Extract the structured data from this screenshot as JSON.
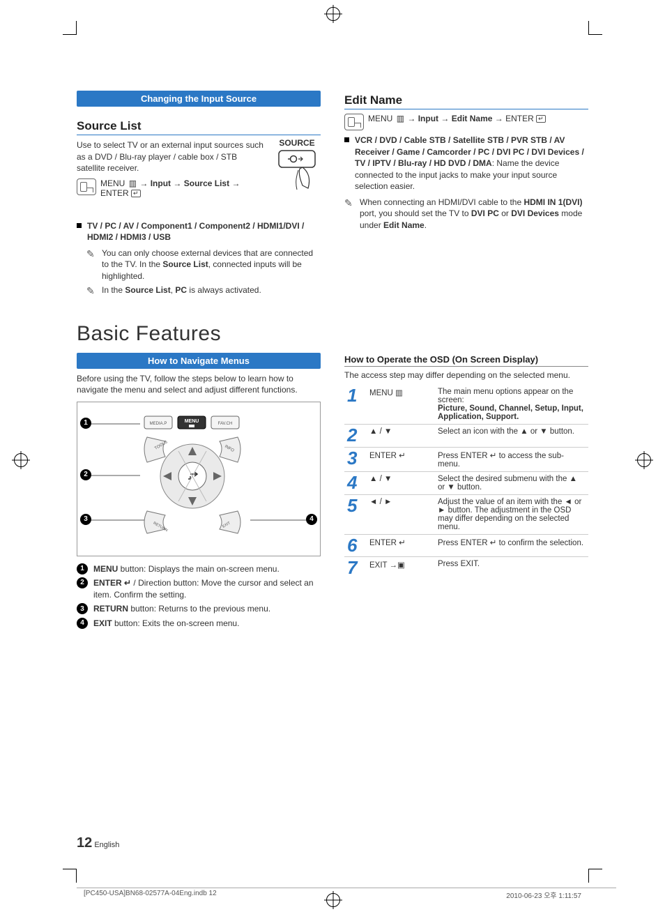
{
  "banners": {
    "changing_input_source": "Changing the Input Source",
    "how_to_navigate": "How to Navigate Menus"
  },
  "sections": {
    "source_list": "Source List",
    "edit_name": "Edit Name",
    "basic_features": "Basic Features",
    "how_to_operate_osd": "How to Operate the OSD (On Screen Display)"
  },
  "source_list": {
    "desc": "Use to select TV or an external input sources such as a DVD / Blu-ray player / cable box / STB satellite receiver.",
    "menu_path_html": "MENU ▥ → Input → Source List → ENTER ↵",
    "menu_path_parts": [
      "MENU",
      "▥",
      "→",
      "Input",
      "→",
      "Source List",
      "→",
      "ENTER",
      "↵"
    ],
    "options_bold": "TV / PC / AV / Component1 / Component2 / HDMI1/DVI / HDMI2 / HDMI3 / USB",
    "note1_pre": "You can only choose external devices that are connected to the TV. In the ",
    "note1_bold1": "Source List",
    "note1_post": ", connected inputs will be highlighted.",
    "note2_pre": "In the ",
    "note2_bold1": "Source List",
    "note2_mid": ", ",
    "note2_bold2": "PC",
    "note2_post": " is always activated.",
    "source_btn_label": "SOURCE"
  },
  "edit_name": {
    "menu_path_parts": [
      "MENU",
      "▥",
      "→",
      "Input",
      "→",
      "Edit Name",
      "→",
      "ENTER",
      "↵"
    ],
    "options_bold": "VCR / DVD / Cable STB / Satellite STB / PVR STB / AV Receiver / Game / Camcorder / PC / DVI PC / DVI Devices / TV / IPTV / Blu-ray / HD DVD / DMA",
    "options_tail": ": Name the device connected to the input jacks to make your input source selection easier.",
    "note_pre": "When connecting an HDMI/DVI cable to the ",
    "note_b1": "HDMI IN 1(DVI)",
    "note_mid1": " port, you should set the TV to ",
    "note_b2": "DVI PC",
    "note_mid2": " or ",
    "note_b3": "DVI Devices",
    "note_mid3": " mode under ",
    "note_b4": "Edit Name",
    "note_post": "."
  },
  "navigate": {
    "intro": "Before using the TV, follow the steps below to learn how to navigate the menu and select and adjust different functions.",
    "remote_buttons": {
      "mediap": "MEDIA.P",
      "menu": "MENU",
      "favch": "FAV.CH",
      "tools": "TOOLS",
      "info": "INFO",
      "return": "RETURN",
      "exit": "EXIT"
    },
    "button_desc": [
      {
        "num": "1",
        "bold": "MENU",
        "text": " button: Displays the main on-screen menu."
      },
      {
        "num": "2",
        "bold": "ENTER ↵",
        "text": " / Direction button: Move the cursor and select an item. Confirm the setting."
      },
      {
        "num": "3",
        "bold": "RETURN",
        "text": " button: Returns to the previous menu."
      },
      {
        "num": "4",
        "bold": "EXIT",
        "text": " button: Exits the on-screen menu."
      }
    ]
  },
  "osd": {
    "intro": "The access step may differ depending on the selected menu.",
    "steps": [
      {
        "n": "1",
        "ctl": "MENU ▥",
        "desc_pre": "The main menu options appear on the screen:",
        "desc_bold": "Picture, Sound, Channel, Setup, Input, Application, Support."
      },
      {
        "n": "2",
        "ctl": "▲ / ▼",
        "desc": "Select an icon with the ▲ or ▼ button."
      },
      {
        "n": "3",
        "ctl": "ENTER ↵",
        "desc": "Press ENTER ↵ to access the sub-menu."
      },
      {
        "n": "4",
        "ctl": "▲ / ▼",
        "desc": "Select the desired submenu with the ▲ or ▼ button."
      },
      {
        "n": "5",
        "ctl": "◄ / ►",
        "desc": "Adjust the value of an item with the ◄ or ► button. The adjustment in the OSD may differ depending on the selected menu."
      },
      {
        "n": "6",
        "ctl": "ENTER ↵",
        "desc": "Press ENTER ↵ to confirm the selection."
      },
      {
        "n": "7",
        "ctl": "EXIT →▣",
        "desc": "Press EXIT."
      }
    ]
  },
  "footer": {
    "page_number": "12",
    "lang": "English",
    "doc_left": "[PC450-USA]BN68-02577A-04Eng.indb   12",
    "doc_right": "2010-06-23   오후 1:11:57"
  }
}
